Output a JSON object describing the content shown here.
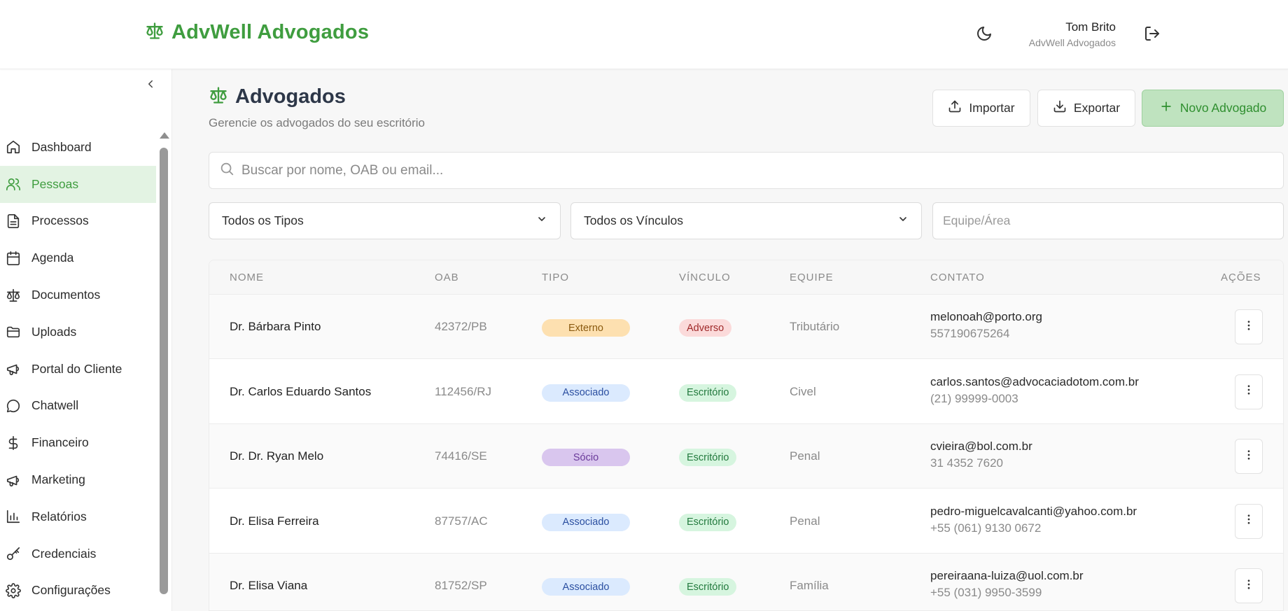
{
  "header": {
    "brand": "AdvWell Advogados",
    "user_name": "Tom Brito",
    "user_org": "AdvWell Advogados"
  },
  "sidebar": {
    "items": [
      {
        "label": "Dashboard",
        "icon": "home-icon"
      },
      {
        "label": "Pessoas",
        "icon": "users-icon",
        "active": true
      },
      {
        "label": "Processos",
        "icon": "file-text-icon"
      },
      {
        "label": "Agenda",
        "icon": "calendar-icon"
      },
      {
        "label": "Documentos",
        "icon": "scale-icon"
      },
      {
        "label": "Uploads",
        "icon": "folder-icon"
      },
      {
        "label": "Portal do Cliente",
        "icon": "megaphone-icon"
      },
      {
        "label": "Chatwell",
        "icon": "chat-icon"
      },
      {
        "label": "Financeiro",
        "icon": "dollar-icon"
      },
      {
        "label": "Marketing",
        "icon": "megaphone-icon"
      },
      {
        "label": "Relatórios",
        "icon": "bar-chart-icon"
      },
      {
        "label": "Credenciais",
        "icon": "key-icon"
      },
      {
        "label": "Configurações",
        "icon": "gear-icon"
      }
    ]
  },
  "page": {
    "title": "Advogados",
    "subtitle": "Gerencie os advogados do seu escritório"
  },
  "toolbar": {
    "import_label": "Importar",
    "export_label": "Exportar",
    "new_label": "Novo Advogado"
  },
  "search": {
    "placeholder": "Buscar por nome, OAB ou email..."
  },
  "filters": {
    "tipo_selected": "Todos os Tipos",
    "vinculo_selected": "Todos os Vínculos",
    "equipe_placeholder": "Equipe/Área"
  },
  "table": {
    "headers": {
      "nome": "NOME",
      "oab": "OAB",
      "tipo": "TIPO",
      "vinculo": "VÍNCULO",
      "equipe": "EQUIPE",
      "contato": "CONTATO",
      "acoes": "AÇÕES"
    },
    "rows": [
      {
        "nome": "Dr. Bárbara Pinto",
        "oab": "42372/PB",
        "tipo": "Externo",
        "vinculo": "Adverso",
        "equipe": "Tributário",
        "email": "melonoah@porto.org",
        "phone": "557190675264"
      },
      {
        "nome": "Dr. Carlos Eduardo Santos",
        "oab": "112456/RJ",
        "tipo": "Associado",
        "vinculo": "Escritório",
        "equipe": "Civel",
        "email": "carlos.santos@advocaciadotom.com.br",
        "phone": "(21) 99999-0003"
      },
      {
        "nome": "Dr. Dr. Ryan Melo",
        "oab": "74416/SE",
        "tipo": "Sócio",
        "vinculo": "Escritório",
        "equipe": "Penal",
        "email": "cvieira@bol.com.br",
        "phone": "31 4352 7620"
      },
      {
        "nome": "Dr. Elisa Ferreira",
        "oab": "87757/AC",
        "tipo": "Associado",
        "vinculo": "Escritório",
        "equipe": "Penal",
        "email": "pedro-miguelcavalcanti@yahoo.com.br",
        "phone": "+55 (061) 9130 0672"
      },
      {
        "nome": "Dr. Elisa Viana",
        "oab": "81752/SP",
        "tipo": "Associado",
        "vinculo": "Escritório",
        "equipe": "Família",
        "email": "pereiraana-luiza@uol.com.br",
        "phone": "+55 (031) 9950-3599"
      }
    ]
  },
  "badge_colors": {
    "Externo": {
      "bg": "#fde0b0",
      "fg": "#8a5a10"
    },
    "Associado": {
      "bg": "#dbeafe",
      "fg": "#2b4fa0"
    },
    "Sócio": {
      "bg": "#d9c6ee",
      "fg": "#6a3a9a"
    },
    "Adverso": {
      "bg": "#fbdada",
      "fg": "#a02a2a"
    },
    "Escritório": {
      "bg": "#d6f5df",
      "fg": "#237a3e"
    }
  },
  "colors": {
    "brand": "#3f9d3f",
    "active_bg": "#e3f3e3"
  }
}
